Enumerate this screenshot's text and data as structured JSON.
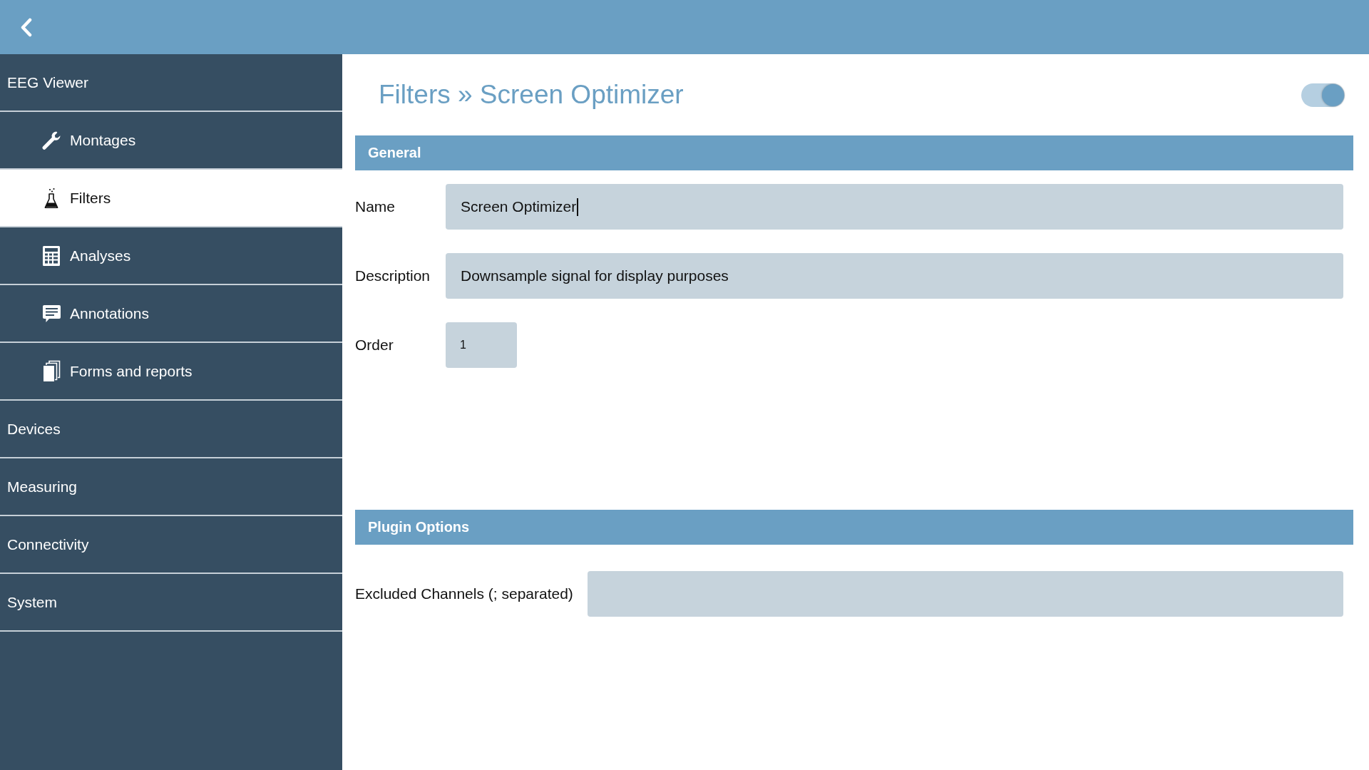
{
  "sidebar": {
    "items": [
      {
        "label": "EEG Viewer",
        "selected": false,
        "children": [
          {
            "label": "Montages",
            "selected": false
          },
          {
            "label": "Filters",
            "selected": true
          },
          {
            "label": "Analyses",
            "selected": false
          },
          {
            "label": "Annotations",
            "selected": false
          },
          {
            "label": "Forms and reports",
            "selected": false
          }
        ]
      },
      {
        "label": "Devices",
        "selected": false
      },
      {
        "label": "Measuring",
        "selected": false
      },
      {
        "label": "Connectivity",
        "selected": false
      },
      {
        "label": "System",
        "selected": false
      }
    ]
  },
  "page": {
    "title": "Filters » Screen Optimizer",
    "toggle": {
      "on": true
    }
  },
  "sections": [
    {
      "title": "General",
      "fields": [
        {
          "label": "Name",
          "kind": "text",
          "value": "Screen Optimizer",
          "focused": true
        },
        {
          "label": "Description",
          "kind": "text",
          "value": "Downsample signal for display purposes",
          "focused": false
        },
        {
          "label": "Order",
          "kind": "number",
          "value": "1",
          "focused": false
        }
      ]
    },
    {
      "title": "Plugin Options",
      "fields": [
        {
          "label": "Excluded Channels (; separated)",
          "kind": "text",
          "focused": false
        }
      ]
    }
  ]
}
